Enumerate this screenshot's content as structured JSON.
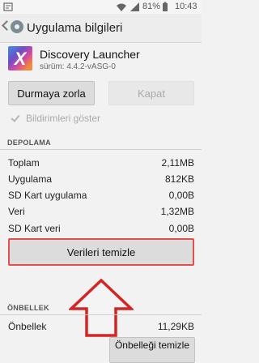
{
  "status_bar": {
    "battery_percent": "81%",
    "time": "10:43"
  },
  "action_bar": {
    "title": "Uygulama bilgileri"
  },
  "app": {
    "icon_letter": "X",
    "name": "Discovery Launcher",
    "version": "sürüm: 4.4.2-vASG-0"
  },
  "buttons": {
    "force_stop": "Durmaya zorla",
    "disable": "Kapat",
    "clear_data": "Verileri temizle",
    "clear_cache": "Önbelleği temizle"
  },
  "notifications": {
    "label": "Bildirimleri göster",
    "checked": true
  },
  "storage": {
    "header": "DEPOLAMA",
    "rows": [
      {
        "label": "Toplam",
        "value": "2,11MB"
      },
      {
        "label": "Uygulama",
        "value": "812KB"
      },
      {
        "label": "SD Kart uygulama",
        "value": "0,00B"
      },
      {
        "label": "Veri",
        "value": "1,32MB"
      },
      {
        "label": "SD Kart veri",
        "value": "0,00B"
      }
    ]
  },
  "cache": {
    "header": "ÖNBELLEK",
    "label": "Önbellek",
    "value": "11,29KB"
  },
  "colors": {
    "arrow": "#d42424",
    "highlight_border": "#e05050"
  }
}
